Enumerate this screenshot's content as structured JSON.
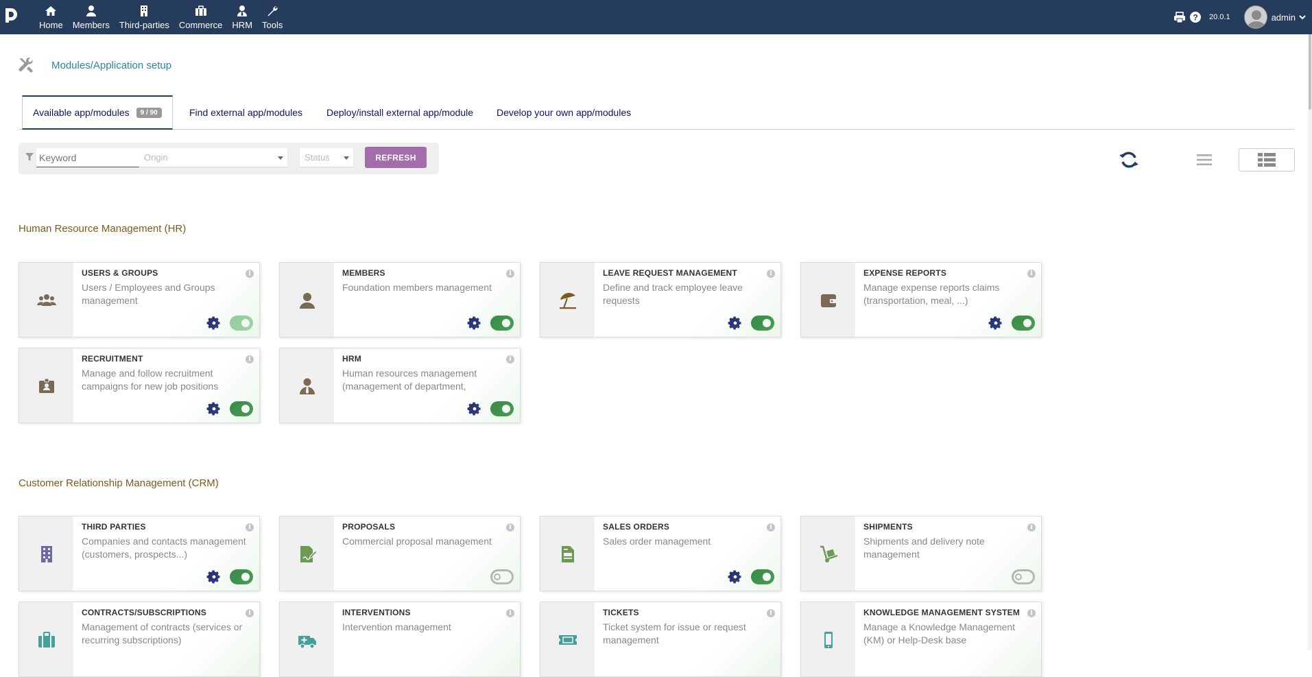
{
  "topbar": {
    "menu": [
      {
        "label": "Home",
        "icon": "home-icon"
      },
      {
        "label": "Members",
        "icon": "user-icon"
      },
      {
        "label": "Third-parties",
        "icon": "building-icon"
      },
      {
        "label": "Commerce",
        "icon": "briefcase-icon"
      },
      {
        "label": "HRM",
        "icon": "person-tie-icon"
      },
      {
        "label": "Tools",
        "icon": "wrench-icon"
      }
    ],
    "version": "20.0.1",
    "user": "admin"
  },
  "page": {
    "title": "Modules/Application setup"
  },
  "tabs": [
    {
      "label": "Available app/modules",
      "badge": "9 / 90"
    },
    {
      "label": "Find external app/modules"
    },
    {
      "label": "Deploy/install external app/module"
    },
    {
      "label": "Develop your own app/modules"
    }
  ],
  "filter": {
    "keyword_placeholder": "Keyword",
    "origin_placeholder": "Origin",
    "status_placeholder": "Status",
    "refresh_label": "REFRESH"
  },
  "sections": [
    {
      "title": "Human Resource Management (HR)",
      "cards": [
        {
          "title": "USERS & GROUPS",
          "desc": "Users / Employees and Groups management",
          "icon": "users-icon",
          "icon_color": "#7a6a55",
          "gear": true,
          "toggle": "on-light"
        },
        {
          "title": "MEMBERS",
          "desc": "Foundation members management",
          "icon": "member-icon",
          "icon_color": "#7a6a55",
          "gear": true,
          "toggle": "on"
        },
        {
          "title": "LEAVE REQUEST MANAGEMENT",
          "desc": "Define and track employee leave requests",
          "icon": "umbrella-beach-icon",
          "icon_color": "#7a5a1e",
          "gear": true,
          "toggle": "on"
        },
        {
          "title": "EXPENSE REPORTS",
          "desc": "Manage expense reports claims (transportation, meal, ...)",
          "icon": "wallet-icon",
          "icon_color": "#7a6a55",
          "gear": true,
          "toggle": "on"
        },
        {
          "title": "RECRUITMENT",
          "desc": "Manage and follow recruitment campaigns for new job positions",
          "icon": "id-badge-icon",
          "icon_color": "#7a6a55",
          "gear": true,
          "toggle": "on"
        },
        {
          "title": "HRM",
          "desc": "Human resources management (management of department, employee…",
          "icon": "person-tie-icon",
          "icon_color": "#7a6a55",
          "gear": true,
          "toggle": "on"
        }
      ]
    },
    {
      "title": "Customer Relationship Management (CRM)",
      "cards": [
        {
          "title": "THIRD PARTIES",
          "desc": "Companies and contacts management (customers, prospects...)",
          "icon": "building-icon",
          "icon_color": "#6c6aa0",
          "gear": true,
          "toggle": "on"
        },
        {
          "title": "PROPOSALS",
          "desc": "Commercial proposal management",
          "icon": "file-signature-icon",
          "icon_color": "#6c9a55",
          "gear": false,
          "toggle": "off"
        },
        {
          "title": "SALES ORDERS",
          "desc": "Sales order management",
          "icon": "file-invoice-icon",
          "icon_color": "#6c9a55",
          "gear": true,
          "toggle": "on"
        },
        {
          "title": "SHIPMENTS",
          "desc": "Shipments and delivery note management",
          "icon": "dolly-icon",
          "icon_color": "#6c9a55",
          "gear": false,
          "toggle": "off"
        },
        {
          "title": "CONTRACTS/SUBSCRIPTIONS",
          "desc": "Management of contracts (services or recurring subscriptions)",
          "icon": "suitcase-icon",
          "icon_color": "#46a09a",
          "gear": false,
          "toggle": "none"
        },
        {
          "title": "INTERVENTIONS",
          "desc": "Intervention management",
          "icon": "ambulance-icon",
          "icon_color": "#46a09a",
          "gear": false,
          "toggle": "none"
        },
        {
          "title": "TICKETS",
          "desc": "Ticket system for issue or request management",
          "icon": "ticket-icon",
          "icon_color": "#46a09a",
          "gear": false,
          "toggle": "none"
        },
        {
          "title": "KNOWLEDGE MANAGEMENT SYSTEM",
          "desc": "Manage a Knowledge Management (KM) or Help-Desk base",
          "icon": "mobile-icon",
          "icon_color": "#46a09a",
          "gear": false,
          "toggle": "none"
        }
      ]
    }
  ]
}
